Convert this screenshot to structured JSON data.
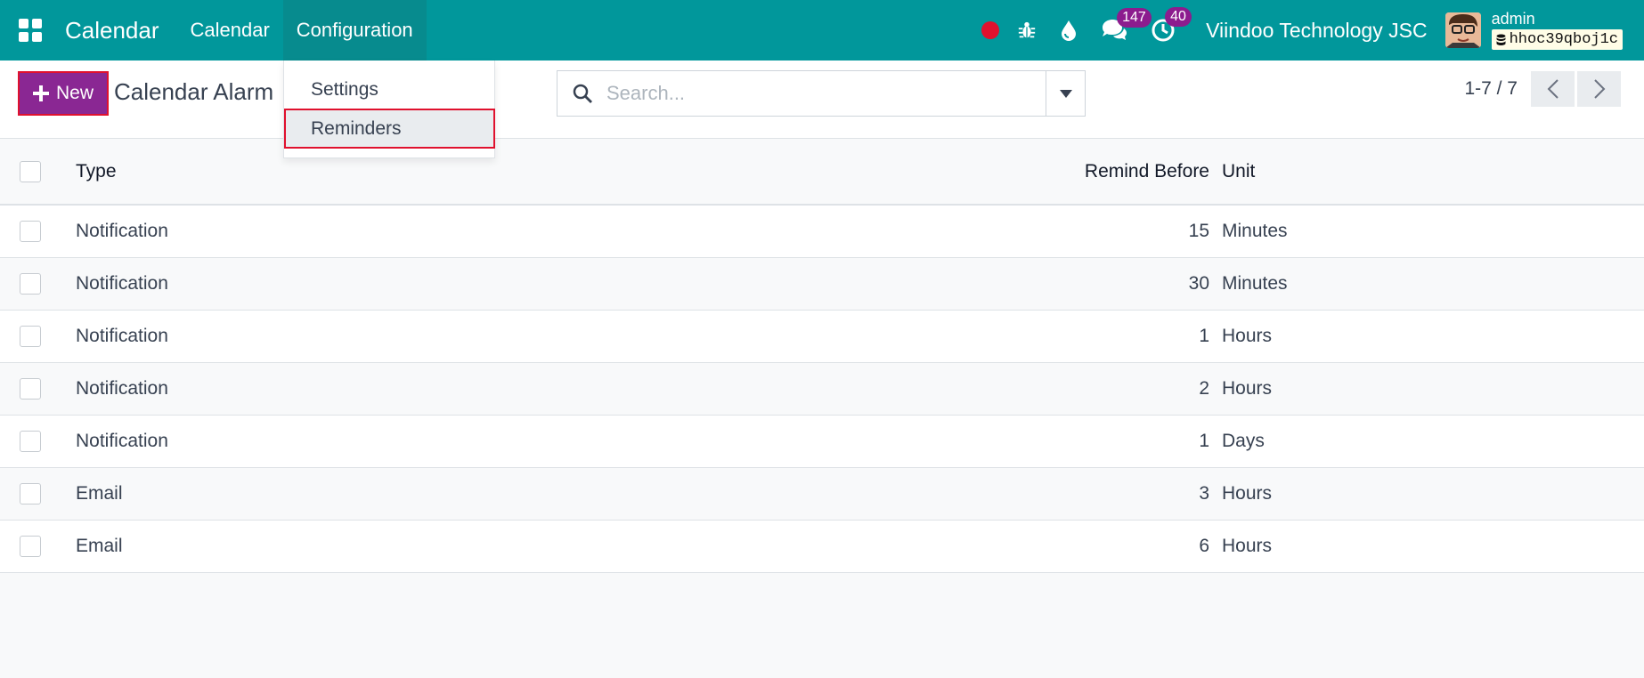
{
  "navbar": {
    "app_name": "Calendar",
    "menu": [
      {
        "label": "Calendar"
      },
      {
        "label": "Configuration"
      }
    ],
    "badges": {
      "messages": "147",
      "activities": "40"
    },
    "company": "Viindoo Technology JSC",
    "user": "admin",
    "database": "hhoc39qboj1c",
    "colors": {
      "navbar_bg": "#01979b",
      "badge_bg": "#8c1c8e",
      "recording_dot": "#e0112e"
    }
  },
  "control_panel": {
    "new_label": "New",
    "breadcrumb": "Calendar Alarm",
    "search_placeholder": "Search...",
    "pager": "1-7 / 7"
  },
  "dropdown": {
    "items": [
      {
        "label": "Settings"
      },
      {
        "label": "Reminders"
      }
    ]
  },
  "table": {
    "headers": {
      "type": "Type",
      "remind_before": "Remind Before",
      "unit": "Unit"
    },
    "rows": [
      {
        "type": "Notification",
        "remind_before": "15",
        "unit": "Minutes"
      },
      {
        "type": "Notification",
        "remind_before": "30",
        "unit": "Minutes"
      },
      {
        "type": "Notification",
        "remind_before": "1",
        "unit": "Hours"
      },
      {
        "type": "Notification",
        "remind_before": "2",
        "unit": "Hours"
      },
      {
        "type": "Notification",
        "remind_before": "1",
        "unit": "Days"
      },
      {
        "type": "Email",
        "remind_before": "3",
        "unit": "Hours"
      },
      {
        "type": "Email",
        "remind_before": "6",
        "unit": "Hours"
      }
    ]
  },
  "accent_colors": {
    "primary_button": "#8a2793",
    "highlight_border": "#e0112e"
  }
}
